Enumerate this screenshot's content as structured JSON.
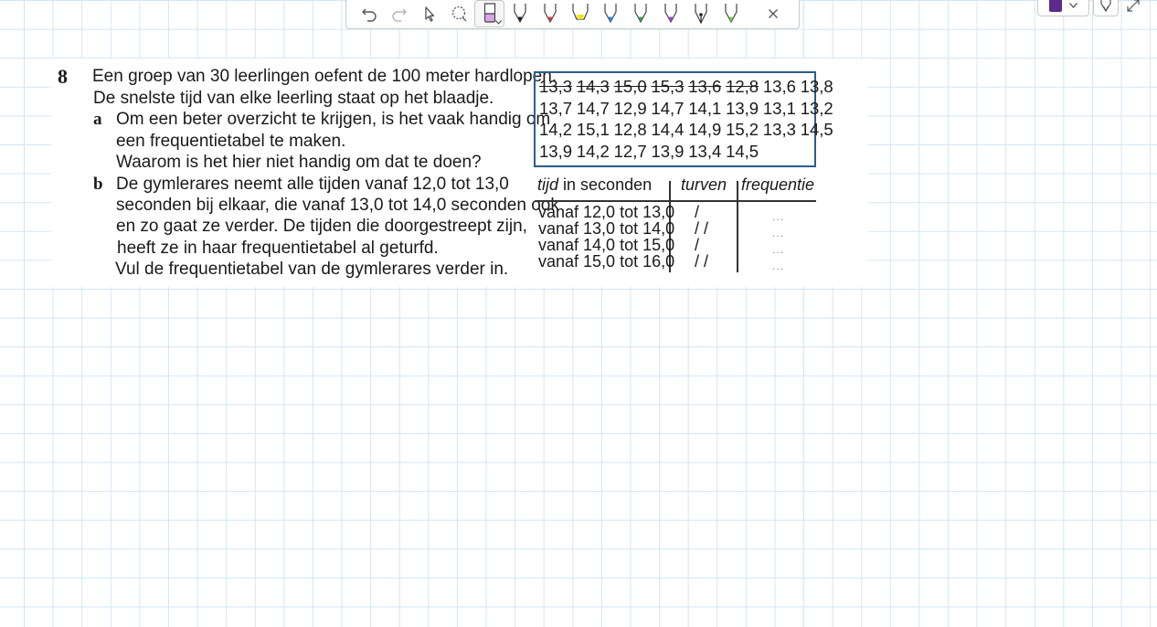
{
  "toolbar": {
    "tools": [
      {
        "name": "undo-icon"
      },
      {
        "name": "redo-icon"
      },
      {
        "name": "pointer-icon"
      },
      {
        "name": "lasso-icon"
      },
      {
        "name": "eraser-icon"
      },
      {
        "name": "pen-black-icon",
        "color": "#222222"
      },
      {
        "name": "pen-red-icon",
        "color": "#e23b3b"
      },
      {
        "name": "highlighter-yellow-icon",
        "color": "#f2e21b"
      },
      {
        "name": "pen-blue-icon",
        "color": "#2f8fe8"
      },
      {
        "name": "pen-green-icon",
        "color": "#2cae4a"
      },
      {
        "name": "pen-purple-icon",
        "color": "#a93ad8"
      },
      {
        "name": "fountain-pen-icon",
        "color": "#222222"
      },
      {
        "name": "pen-lime-icon",
        "color": "#7ad14a"
      }
    ],
    "active_color": "#5b2a8a"
  },
  "question": {
    "number": "8",
    "intro": [
      "Een groep van 30 leerlingen oefent de 100 meter hardlopen.",
      "De snelste tijd van elke leerling staat op het blaadje."
    ],
    "a_label": "a",
    "a_lines": [
      "Om een beter overzicht te krijgen, is het vaak handig om",
      "een frequentietabel te maken.",
      "Waarom is het hier niet handig om dat te doen?"
    ],
    "b_label": "b",
    "b_lines": [
      "De gymlerares neemt alle tijden vanaf 12,0 tot 13,0",
      "seconden bij elkaar, die vanaf 13,0 tot 14,0 seconden ook",
      "en zo gaat ze verder. De tijden die doorgestreept zijn,",
      "heeft ze in haar frequentietabel al geturfd.",
      "Vul de frequentietabel van de gymlerares verder in."
    ]
  },
  "times": [
    [
      "13,3",
      "14,3",
      "15,0",
      "15,3",
      "13,6",
      "12,8",
      "13,6",
      "13,8"
    ],
    [
      "13,7",
      "14,7",
      "12,9",
      "14,7",
      "14,1",
      "13,9",
      "13,1",
      "13,2"
    ],
    [
      "14,2",
      "15,1",
      "12,8",
      "14,4",
      "14,9",
      "15,2",
      "13,3",
      "14,5"
    ],
    [
      "13,9",
      "14,2",
      "12,7",
      "13,9",
      "13,4",
      "14,5"
    ]
  ],
  "struck_count": 6,
  "freq_table": {
    "header_tijd": "tijd",
    "header_in_seconden": "in seconden",
    "header_turven": "turven",
    "header_frequentie": "frequentie",
    "rows": [
      {
        "range": "vanaf 12,0 tot 13,0",
        "tally": "/",
        "freq": "..."
      },
      {
        "range": "vanaf 13,0 tot 14,0",
        "tally": "/ /",
        "freq": "..."
      },
      {
        "range": "vanaf 14,0 tot 15,0",
        "tally": "/",
        "freq": "..."
      },
      {
        "range": "vanaf 15,0 tot 16,0",
        "tally": "/ /",
        "freq": "..."
      }
    ]
  }
}
